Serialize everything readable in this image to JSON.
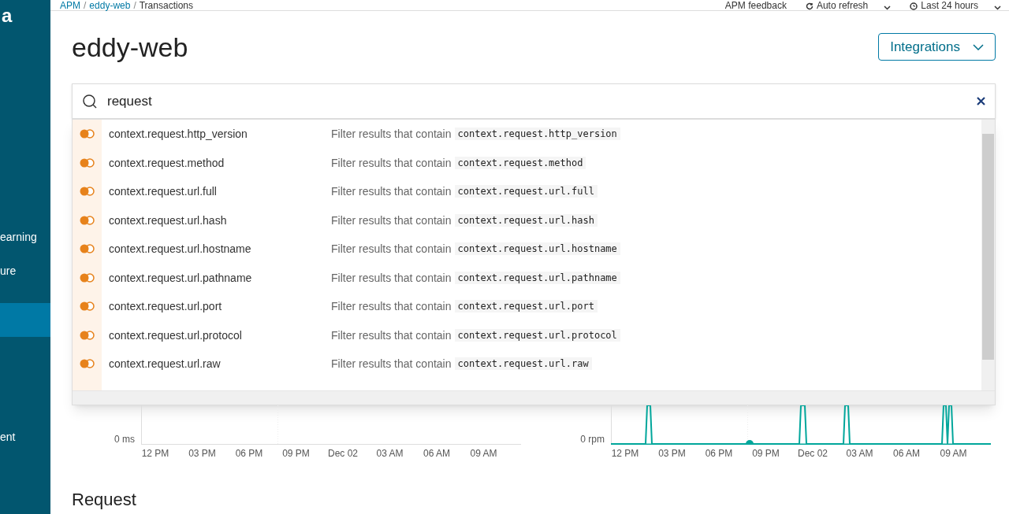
{
  "breadcrumbs": [
    {
      "label": "APM",
      "kind": "link"
    },
    {
      "label": "/",
      "kind": "separator"
    },
    {
      "label": "eddy-web",
      "kind": "link"
    },
    {
      "label": "/",
      "kind": "separator"
    },
    {
      "label": "Transactions",
      "kind": "current"
    }
  ],
  "header_links": [
    {
      "label": "APM feedback",
      "kind": "link"
    },
    {
      "label": "Auto refresh",
      "kind": "refresh"
    },
    {
      "label": "Last 24 hours",
      "kind": "time"
    }
  ],
  "sidebar": {
    "logo": "a",
    "items": [
      {
        "label": "earning",
        "selected": false
      },
      {
        "label": "ure",
        "selected": false
      },
      {
        "selected": true
      },
      {
        "label": "ent",
        "selected": false
      }
    ]
  },
  "title": "eddy-web",
  "integrations_button": "Integrations",
  "search": {
    "value": "request"
  },
  "suggestions": [
    {
      "field": "context.request.http_version",
      "hint": "Filter results that contain",
      "code": "context.request.http_version"
    },
    {
      "field": "context.request.method",
      "hint": "Filter results that contain",
      "code": "context.request.method"
    },
    {
      "field": "context.request.url.full",
      "hint": "Filter results that contain",
      "code": "context.request.url.full"
    },
    {
      "field": "context.request.url.hash",
      "hint": "Filter results that contain",
      "code": "context.request.url.hash"
    },
    {
      "field": "context.request.url.hostname",
      "hint": "Filter results that contain",
      "code": "context.request.url.hostname"
    },
    {
      "field": "context.request.url.pathname",
      "hint": "Filter results that contain",
      "code": "context.request.url.pathname"
    },
    {
      "field": "context.request.url.port",
      "hint": "Filter results that contain",
      "code": "context.request.url.port"
    },
    {
      "field": "context.request.url.protocol",
      "hint": "Filter results that contain",
      "code": "context.request.url.protocol"
    },
    {
      "field": "context.request.url.raw",
      "hint": "Filter results that contain",
      "code": "context.request.url.raw"
    }
  ],
  "charts": [
    {
      "y_label": "0 ms",
      "x_labels": [
        "12 PM",
        "03 PM",
        "06 PM",
        "09 PM",
        "Dec 02",
        "03 AM",
        "06 AM",
        "09 AM"
      ],
      "kind": "empty"
    },
    {
      "y_label": "0 rpm",
      "x_labels": [
        "12 PM",
        "03 PM",
        "06 PM",
        "09 PM",
        "Dec 02",
        "03 AM",
        "06 AM",
        "09 AM"
      ],
      "kind": "line"
    }
  ],
  "section_heading": "Request"
}
